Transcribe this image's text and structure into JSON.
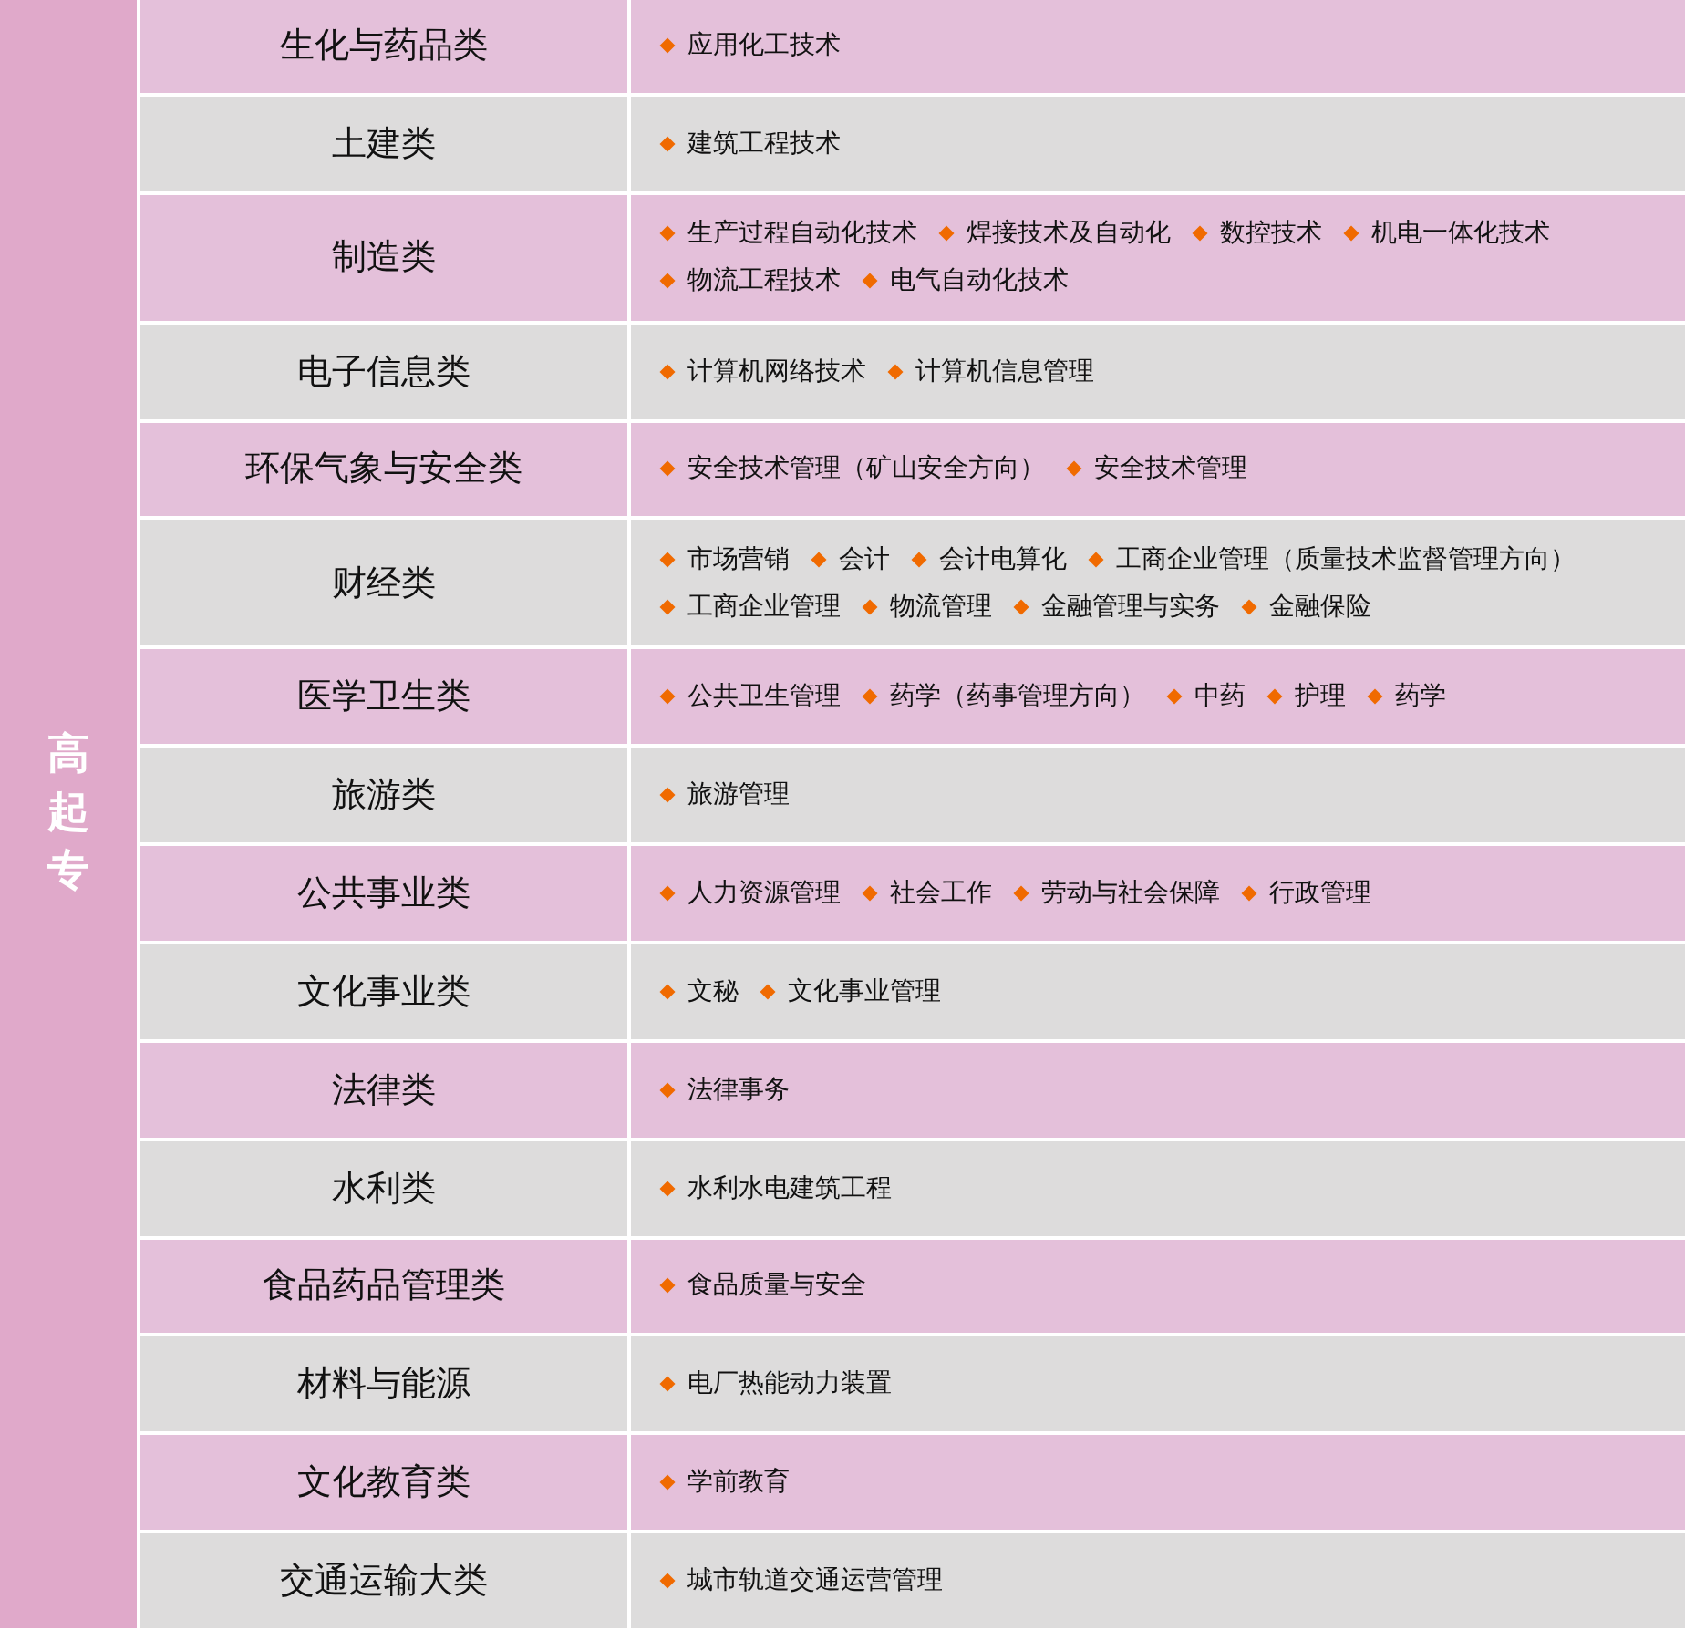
{
  "level_label": "高起专",
  "rows": [
    {
      "category": "生化与药品类",
      "lines": [
        [
          "应用化工技术"
        ]
      ]
    },
    {
      "category": "土建类",
      "lines": [
        [
          "建筑工程技术"
        ]
      ]
    },
    {
      "category": "制造类",
      "lines": [
        [
          "生产过程自动化技术",
          "焊接技术及自动化",
          "数控技术",
          "机电一体化技术"
        ],
        [
          "物流工程技术",
          "电气自动化技术"
        ]
      ]
    },
    {
      "category": "电子信息类",
      "lines": [
        [
          "计算机网络技术",
          "计算机信息管理"
        ]
      ]
    },
    {
      "category": "环保气象与安全类",
      "lines": [
        [
          "安全技术管理（矿山安全方向）",
          "安全技术管理"
        ]
      ]
    },
    {
      "category": "财经类",
      "lines": [
        [
          "市场营销",
          "会计",
          "会计电算化",
          "工商企业管理（质量技术监督管理方向）"
        ],
        [
          "工商企业管理",
          "物流管理",
          "金融管理与实务",
          "金融保险"
        ]
      ]
    },
    {
      "category": "医学卫生类",
      "lines": [
        [
          "公共卫生管理",
          "药学（药事管理方向）",
          "中药",
          "护理",
          "药学"
        ]
      ]
    },
    {
      "category": "旅游类",
      "lines": [
        [
          "旅游管理"
        ]
      ]
    },
    {
      "category": "公共事业类",
      "lines": [
        [
          "人力资源管理",
          "社会工作",
          "劳动与社会保障",
          "行政管理"
        ]
      ]
    },
    {
      "category": "文化事业类",
      "lines": [
        [
          "文秘",
          "文化事业管理"
        ]
      ]
    },
    {
      "category": "法律类",
      "lines": [
        [
          "法律事务"
        ]
      ]
    },
    {
      "category": "水利类",
      "lines": [
        [
          "水利水电建筑工程"
        ]
      ]
    },
    {
      "category": "食品药品管理类",
      "lines": [
        [
          "食品质量与安全"
        ]
      ]
    },
    {
      "category": "材料与能源",
      "lines": [
        [
          "电厂热能动力装置"
        ]
      ]
    },
    {
      "category": "文化教育类",
      "lines": [
        [
          "学前教育"
        ]
      ]
    },
    {
      "category": "交通运输大类",
      "lines": [
        [
          "城市轨道交通运营管理"
        ]
      ]
    }
  ]
}
